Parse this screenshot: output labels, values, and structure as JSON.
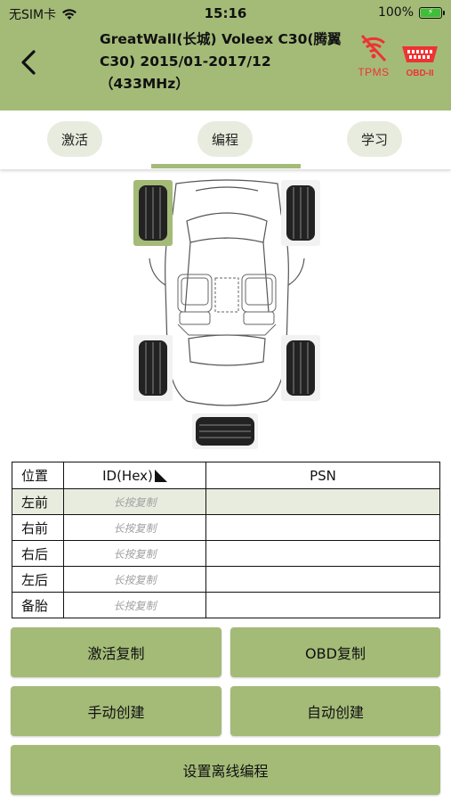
{
  "status_bar": {
    "carrier": "无SIM卡",
    "time": "15:16",
    "battery": "100%"
  },
  "header": {
    "title": "GreatWall(长城) Voleex C30(腾翼C30) 2015/01-2017/12（433MHz）",
    "tpms_label": "TPMS",
    "obd_label": "OBD-II"
  },
  "tabs": [
    {
      "label": "激活"
    },
    {
      "label": "编程"
    },
    {
      "label": "学习"
    }
  ],
  "active_tab": "编程",
  "table": {
    "headers": {
      "position": "位置",
      "id": "ID(Hex)",
      "psn": "PSN"
    },
    "rows": [
      {
        "position": "左前",
        "id_hint": "长按复制",
        "psn": ""
      },
      {
        "position": "右前",
        "id_hint": "长按复制",
        "psn": ""
      },
      {
        "position": "右后",
        "id_hint": "长按复制",
        "psn": ""
      },
      {
        "position": "左后",
        "id_hint": "长按复制",
        "psn": ""
      },
      {
        "position": "备胎",
        "id_hint": "长按复制",
        "psn": ""
      }
    ]
  },
  "buttons": {
    "activate_copy": "激活复制",
    "obd_copy": "OBD复制",
    "manual_create": "手动创建",
    "auto_create": "自动创建",
    "offline_program": "设置离线编程"
  },
  "colors": {
    "accent": "#a4bb78",
    "selected_row": "#e8ecde",
    "logo_red": "#e33333"
  }
}
